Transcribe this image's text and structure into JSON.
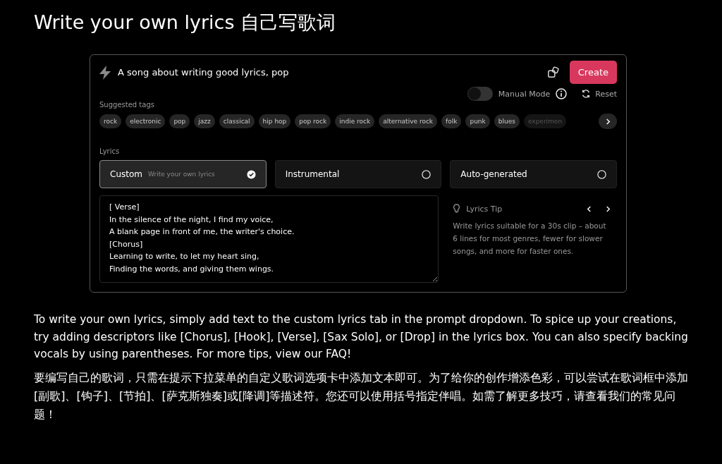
{
  "heading": "Write your own lyrics 自己写歌词",
  "prompt": {
    "value": "A song about writing good lyrics, pop",
    "create_button": "Create"
  },
  "manual_mode": {
    "label": "Manual Mode",
    "on": false
  },
  "reset_button": "Reset",
  "suggested_tags": {
    "label": "Suggested tags",
    "tags": [
      {
        "label": "rock",
        "faded": false
      },
      {
        "label": "electronic",
        "faded": false
      },
      {
        "label": "pop",
        "faded": false
      },
      {
        "label": "jazz",
        "faded": false
      },
      {
        "label": "classical",
        "faded": false
      },
      {
        "label": "hip hop",
        "faded": false
      },
      {
        "label": "pop rock",
        "faded": false
      },
      {
        "label": "indie rock",
        "faded": false
      },
      {
        "label": "alternative rock",
        "faded": false
      },
      {
        "label": "folk",
        "faded": false
      },
      {
        "label": "punk",
        "faded": false
      },
      {
        "label": "blues",
        "faded": false
      },
      {
        "label": "experimen",
        "faded": true
      }
    ]
  },
  "lyrics": {
    "label": "Lyrics",
    "options": [
      {
        "label": "Custom",
        "hint": "Write your own lyrics",
        "selected": true
      },
      {
        "label": "Instrumental",
        "selected": false
      },
      {
        "label": "Auto-generated",
        "selected": false
      }
    ],
    "text": "[ Verse]\nIn the silence of the night, I find my voice,\nA blank page in front of me, the writer's choice.\n[Chorus]\nLearning to write, to let my heart sing,\nFinding the words, and giving them wings."
  },
  "tip": {
    "title": "Lyrics Tip",
    "body": "Write lyrics suitable for a 30s clip – about 6 lines for most genres, fewer for slower songs, and more for faster ones."
  },
  "paragraphs": [
    "To write your own lyrics, simply add text to the custom lyrics tab in the prompt dropdown. To spice up your creations, try adding descriptors like [Chorus], [Hook], [Verse], [Sax Solo], or [Drop] in the lyrics box. You can also specify backing vocals by using parentheses. For more tips, view our FAQ!",
    "要编写自己的歌词，只需在提示下拉菜单的自定义歌词选项卡中添加文本即可。为了给你的创作增添色彩，可以尝试在歌词框中添加[副歌]、[钩子]、[节拍]、[萨克斯独奏]或[降调]等描述符。您还可以使用括号指定伴唱。如需了解更多技巧，请查看我们的常见问题！"
  ]
}
